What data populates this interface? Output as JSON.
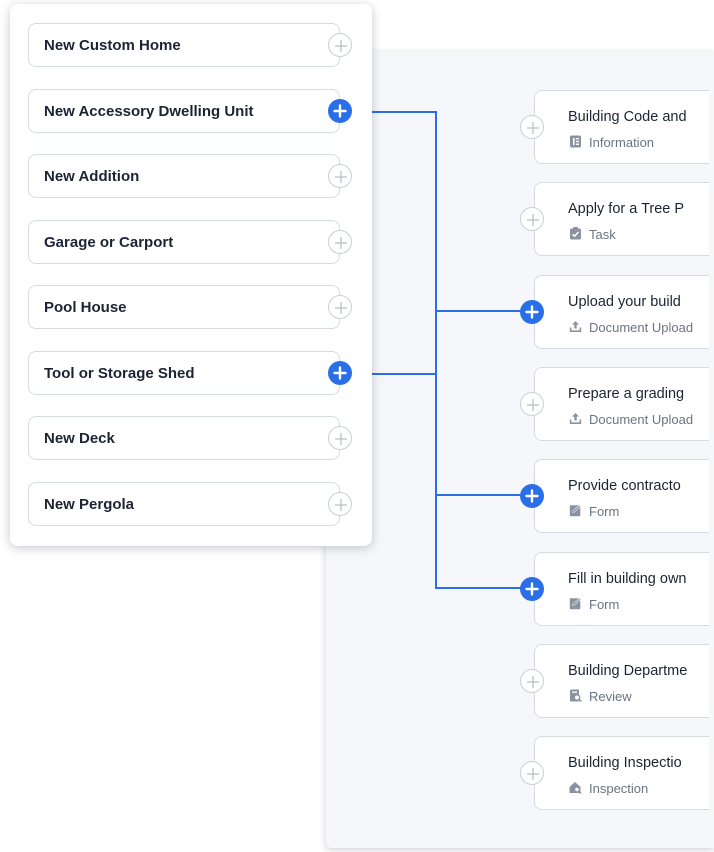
{
  "project_types": [
    {
      "label": "New Custom Home",
      "active": false
    },
    {
      "label": "New Accessory Dwelling Unit",
      "active": true
    },
    {
      "label": "New Addition",
      "active": false
    },
    {
      "label": "Garage or Carport",
      "active": false
    },
    {
      "label": "Pool House",
      "active": false
    },
    {
      "label": "Tool or Storage Shed",
      "active": true
    },
    {
      "label": "New Deck",
      "active": false
    },
    {
      "label": "New Pergola",
      "active": false
    }
  ],
  "steps": [
    {
      "title": "Building Code and",
      "type": "Information",
      "icon": "information-icon",
      "active": false
    },
    {
      "title": "Apply for a Tree P",
      "type": "Task",
      "icon": "task-icon",
      "active": false
    },
    {
      "title": "Upload your build",
      "type": "Document Upload",
      "icon": "upload-icon",
      "active": true
    },
    {
      "title": "Prepare a grading",
      "type": "Document Upload",
      "icon": "upload-icon",
      "active": false
    },
    {
      "title": "Provide contracto",
      "type": "Form",
      "icon": "form-icon",
      "active": true
    },
    {
      "title": "Fill in building own",
      "type": "Form",
      "icon": "form-icon",
      "active": true
    },
    {
      "title": "Building Departme",
      "type": "Review",
      "icon": "review-icon",
      "active": false
    },
    {
      "title": "Building Inspectio",
      "type": "Inspection",
      "icon": "inspection-icon",
      "active": false
    }
  ],
  "colors": {
    "accent": "#2a6ee8",
    "border": "#d6dbe3",
    "text": "#1c2433",
    "muted": "#6b7482",
    "panel": "#f5f7fa"
  }
}
